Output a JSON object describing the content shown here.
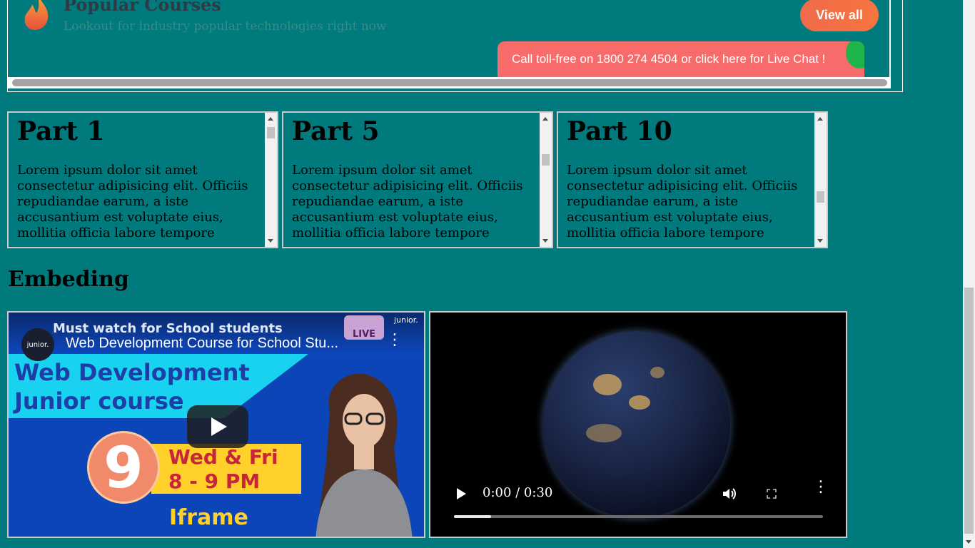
{
  "top_frame": {
    "title": "Popular Courses",
    "subtitle": "Lookout for industry popular technologies right now",
    "view_all": "View all",
    "tollfree": "Call toll-free on 1800 274 4504 or click here for Live Chat !"
  },
  "parts": [
    {
      "title": "Part 1",
      "text": "Lorem ipsum dolor sit amet consectetur adipisicing elit. Officiis repudiandae earum, a iste accusantium est voluptate eius, mollitia officia labore tempore",
      "scroll_position": 0.05
    },
    {
      "title": "Part 5",
      "text": "Lorem ipsum dolor sit amet consectetur adipisicing elit. Officiis repudiandae earum, a iste accusantium est voluptate eius, mollitia officia labore tempore",
      "scroll_position": 0.38
    },
    {
      "title": "Part 10",
      "text": "Lorem ipsum dolor sit amet consectetur adipisicing elit. Officiis repudiandae earum, a iste accusantium est voluptate eius, mollitia officia labore tempore",
      "scroll_position": 0.8
    }
  ],
  "embed": {
    "heading": "Embeding",
    "youtube": {
      "video_title": "Web Development Course for School Stu...",
      "banner": "Must watch for School students",
      "headline_line1": "Web Development",
      "headline_line2": "Junior course",
      "number": "9",
      "days": "Wed & Fri",
      "time": "8 - 9 PM",
      "iframe_label": "Iframe",
      "live": "LIVE",
      "channel": "junior."
    },
    "video": {
      "time": "0:00 / 0:30",
      "progress": 0.1
    }
  },
  "colors": {
    "page_bg": "#007a7c",
    "view_all": "#f06a4a",
    "tollfree": "#f76b6b",
    "leaf": "#1eb54a"
  }
}
